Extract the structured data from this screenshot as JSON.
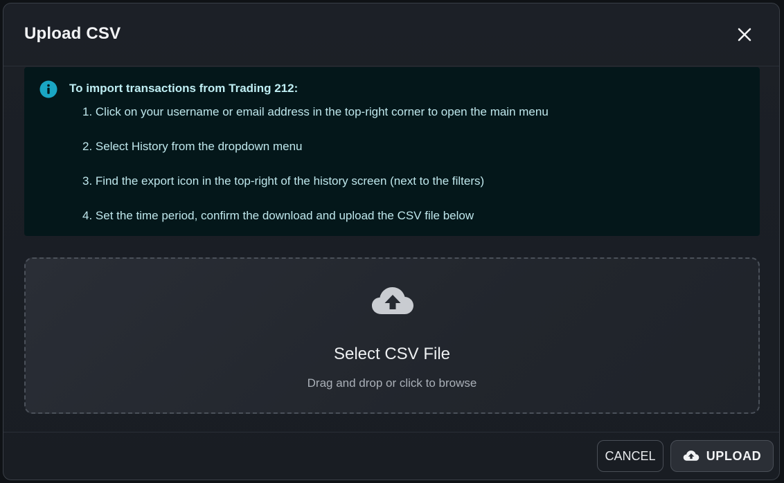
{
  "dialog": {
    "title": "Upload CSV",
    "close_icon": "close-icon"
  },
  "info": {
    "icon": "info-icon",
    "heading": "To import transactions from Trading 212:",
    "steps": [
      "1. Click on your username or email address in the top-right corner to open the main menu",
      "2. Select History from the dropdown menu",
      "3. Find the export icon in the top-right of the history screen (next to the filters)",
      "4. Set the time period, confirm the download and upload the CSV file below"
    ]
  },
  "dropzone": {
    "icon": "cloud-upload-icon",
    "title": "Select CSV File",
    "subtitle": "Drag and drop or click to browse"
  },
  "footer": {
    "cancel_label": "CANCEL",
    "upload_label": "UPLOAD",
    "upload_icon": "cloud-upload-icon"
  },
  "colors": {
    "info_accent": "#1aa6c4",
    "info_background": "#04171a",
    "dialog_background": "#1c2027"
  }
}
